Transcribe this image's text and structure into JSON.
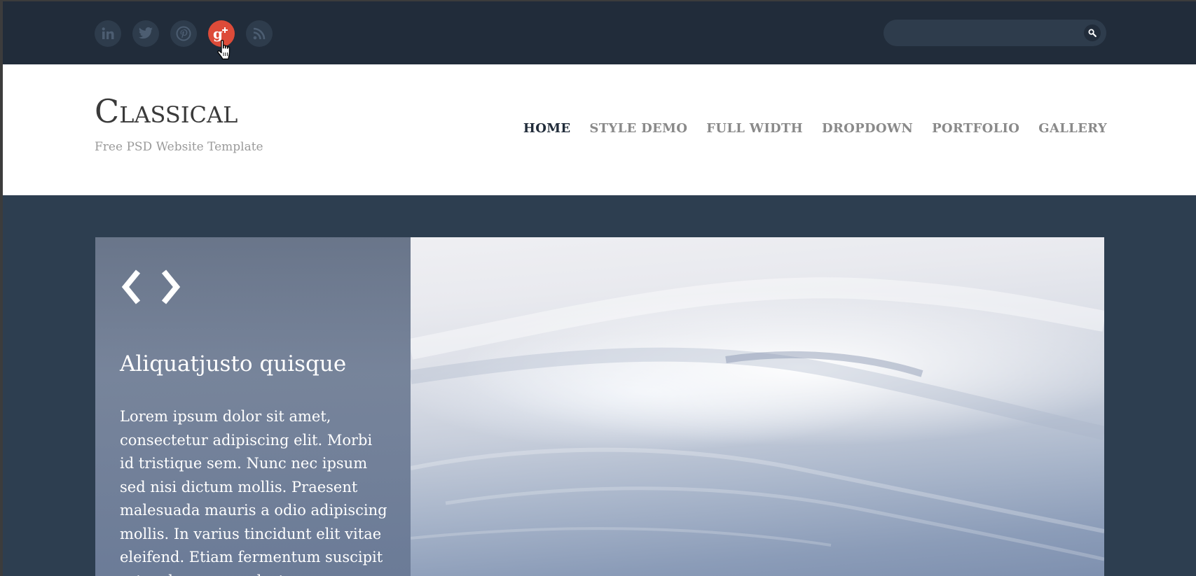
{
  "topbar": {
    "social": [
      {
        "name": "linkedin",
        "glyph": "in",
        "active": false
      },
      {
        "name": "twitter",
        "glyph": "t",
        "active": false
      },
      {
        "name": "pinterest",
        "glyph": "p",
        "active": false
      },
      {
        "name": "google-plus",
        "glyph": "g+",
        "active": true
      },
      {
        "name": "rss",
        "glyph": "rss",
        "active": false
      }
    ],
    "search": {
      "placeholder": "",
      "value": ""
    }
  },
  "header": {
    "logo": "Classical",
    "tagline": "Free PSD Website Template",
    "nav": [
      {
        "label": "HOME",
        "active": true
      },
      {
        "label": "STYLE DEMO",
        "active": false
      },
      {
        "label": "FULL WIDTH",
        "active": false
      },
      {
        "label": "DROPDOWN",
        "active": false
      },
      {
        "label": "PORTFOLIO",
        "active": false
      },
      {
        "label": "GALLERY",
        "active": false
      }
    ]
  },
  "slider": {
    "title": "Aliquatjusto quisque",
    "text": "Lorem ipsum dolor sit amet, consectetur adipiscing elit. Morbi id tristique sem. Nunc nec ipsum sed nisi dictum mollis. Praesent malesuada mauris a odio adipiscing mollis. In varius tincidunt elit vitae eleifend. Etiam fermentum suscipit est, vel accumsan lectus."
  },
  "colors": {
    "topbar": "#212c3a",
    "page": "#2d3e50",
    "google_plus": "#dd4b39",
    "nav_active": "#212c3a",
    "nav_inactive": "#8a8a8a"
  }
}
